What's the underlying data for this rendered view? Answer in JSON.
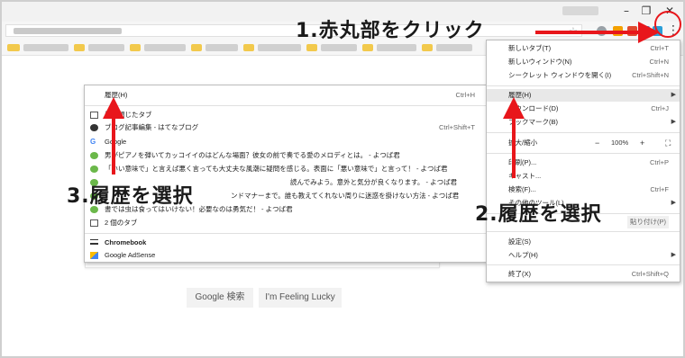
{
  "colors": {
    "annotation_red": "#e8161b",
    "menu_highlight": "#e8e8e8"
  },
  "window_controls": {
    "minimize": "–",
    "restore": "❐",
    "close": "✕"
  },
  "toolbar": {
    "bookmark_icon": "☆",
    "menu_icon": "⋮"
  },
  "google": {
    "search_button": "Google 検索",
    "lucky_button": "I'm Feeling Lucky"
  },
  "history_submenu": {
    "items": [
      {
        "label": "履歴(H)",
        "shortcut": "Ctrl+H",
        "icon": ""
      },
      {
        "label": "最近閉じたタブ",
        "shortcut": "",
        "icon": "tab-icon"
      },
      {
        "label": "ブログ記事編集 - はてなブログ",
        "shortcut": "Ctrl+Shift+T",
        "icon": "hatena-icon"
      },
      {
        "label": "Google",
        "shortcut": "",
        "icon": "google-icon"
      },
      {
        "label": "男がピアノを弾いてカッコイイのはどんな場面？彼女の前で奏でる愛のメロディとは。 - よつば君",
        "shortcut": "",
        "icon": "clover-icon"
      },
      {
        "label": "「いい意味で」と言えば悪く言っても大丈夫な風潮に疑問を感じる。表面に「悪い意味で」と言って！ - よつば君",
        "shortcut": "",
        "icon": "clover-icon"
      },
      {
        "label": "読んでみよう。意外と気分が良くなります。 - よつば君",
        "shortcut": "",
        "icon": "clover-icon"
      },
      {
        "label": "ンドマナーまで。誰も教えてくれない周りに迷惑を掛けない方法 - よつば君",
        "shortcut": "",
        "icon": "clover-icon"
      },
      {
        "label": "書では虫は食ってはいけない！必要なのは勇気だ！ - よつば君",
        "shortcut": "",
        "icon": "clover-icon"
      },
      {
        "label": "2 個のタブ",
        "shortcut": "",
        "icon": "tab-icon"
      }
    ],
    "devices": [
      {
        "label": "Chromebook",
        "icon": "laptop-icon"
      },
      {
        "label": "Google AdSense",
        "icon": "adsense-icon"
      }
    ]
  },
  "chrome_menu": {
    "new_tab": {
      "label": "新しいタブ(T)",
      "shortcut": "Ctrl+T"
    },
    "new_window": {
      "label": "新しいウィンドウ(N)",
      "shortcut": "Ctrl+N"
    },
    "incognito": {
      "label": "シークレット ウィンドウを開く(I)",
      "shortcut": "Ctrl+Shift+N"
    },
    "history": {
      "label": "履歴(H)"
    },
    "downloads": {
      "label": "ダウンロード(D)",
      "shortcut": "Ctrl+J"
    },
    "bookmarks": {
      "label": "ブックマーク(B)"
    },
    "zoom": {
      "label": "拡大/縮小",
      "minus": "−",
      "value": "100%",
      "plus": "+",
      "fullscreen": "⛶"
    },
    "print": {
      "label": "印刷(P)...",
      "shortcut": "Ctrl+P"
    },
    "cast": {
      "label": "キャスト..."
    },
    "find": {
      "label": "検索(F)...",
      "shortcut": "Ctrl+F"
    },
    "more_tools": {
      "label": "その他のツール(L)"
    },
    "edit": {
      "label": "貼り付け(P)"
    },
    "settings": {
      "label": "設定(S)"
    },
    "help": {
      "label": "ヘルプ(H)"
    },
    "exit": {
      "label": "終了(X)",
      "shortcut": "Ctrl+Shift+Q"
    }
  },
  "annotations": {
    "step1": "1.赤丸部をクリック",
    "step2": "2.履歴を選択",
    "step3": "3.履歴を選択"
  }
}
